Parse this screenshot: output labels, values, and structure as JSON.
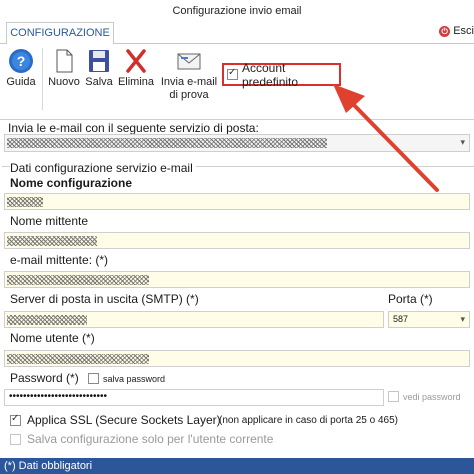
{
  "window": {
    "title": "Configurazione invio email"
  },
  "tabs": [
    {
      "label": "CONFIGURAZIONE"
    }
  ],
  "exit": {
    "label": "Esci"
  },
  "toolbar": {
    "guida": "Guida",
    "nuovo": "Nuovo",
    "salva": "Salva",
    "elimina": "Elimina",
    "invia_line1": "Invia e-mail",
    "invia_line2": "di prova",
    "account_predefinito": "Account predefinito",
    "account_predefinito_checked": true
  },
  "service": {
    "label": "Invia le e-mail con il seguente servizio di posta:"
  },
  "group": {
    "title": "Dati configurazione servizio e-mail",
    "nome_configurazione_label": "Nome configurazione",
    "nome_mittente_label": "Nome mittente",
    "email_mittente_label": "e-mail mittente: (*)",
    "server_label": "Server di posta in uscita (SMTP) (*)",
    "porta_label": "Porta (*)",
    "porta_value": "587",
    "nome_utente_label": "Nome utente (*)",
    "password_label": "Password (*)",
    "salva_password_label": "salva password",
    "password_value": "••••••••••••••••••••••••••••",
    "vedi_password_label": "vedi password",
    "ssl_label": "Applica SSL (Secure Sockets Layer)",
    "ssl_note": "(non applicare in caso di porta 25 o 465)",
    "ssl_checked": true,
    "salva_config_label": "Salva configurazione solo per l'utente corrente"
  },
  "status": {
    "text": "(*) Dati obbligatori"
  },
  "colors": {
    "accent": "#2b579a",
    "highlight": "#d9302b",
    "field_bg": "#fffde7"
  }
}
